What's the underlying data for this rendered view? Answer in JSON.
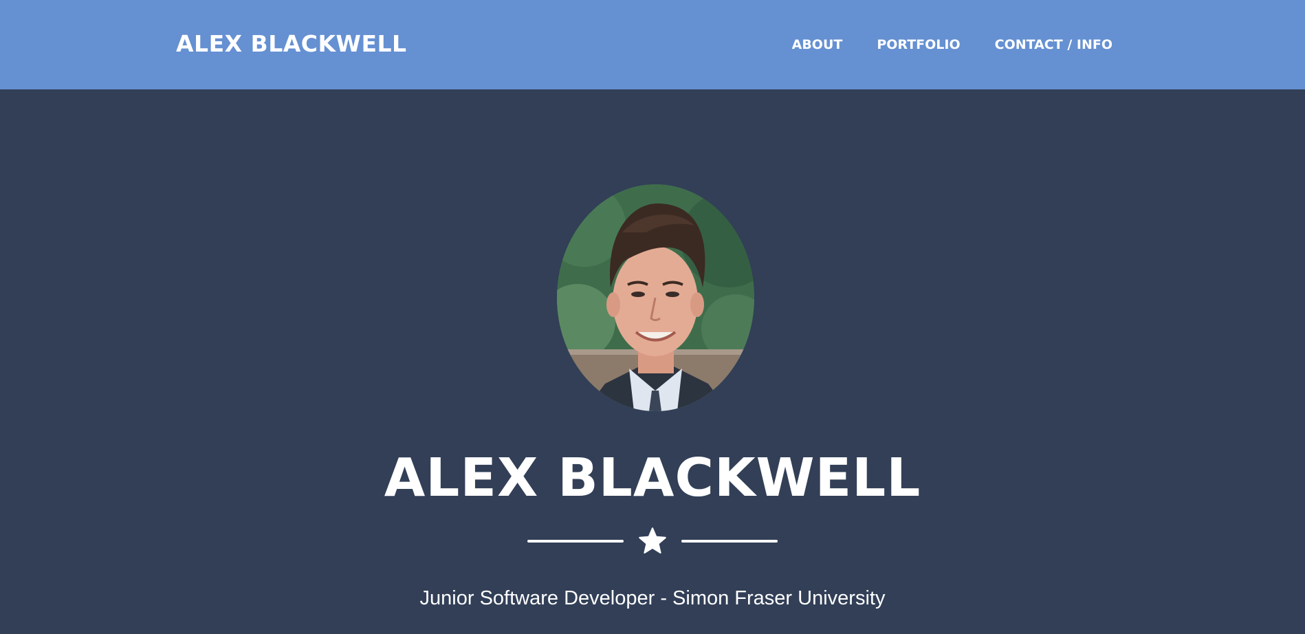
{
  "navbar": {
    "brand": "ALEX BLACKWELL",
    "links": [
      {
        "label": "ABOUT"
      },
      {
        "label": "PORTFOLIO"
      },
      {
        "label": "CONTACT / INFO"
      }
    ],
    "background_color": "#6590d2"
  },
  "hero": {
    "name": "ALEX BLACKWELL",
    "divider_icon": "star-icon",
    "tagline": "Junior Software Developer - Simon Fraser University",
    "background_color": "#323f57"
  }
}
